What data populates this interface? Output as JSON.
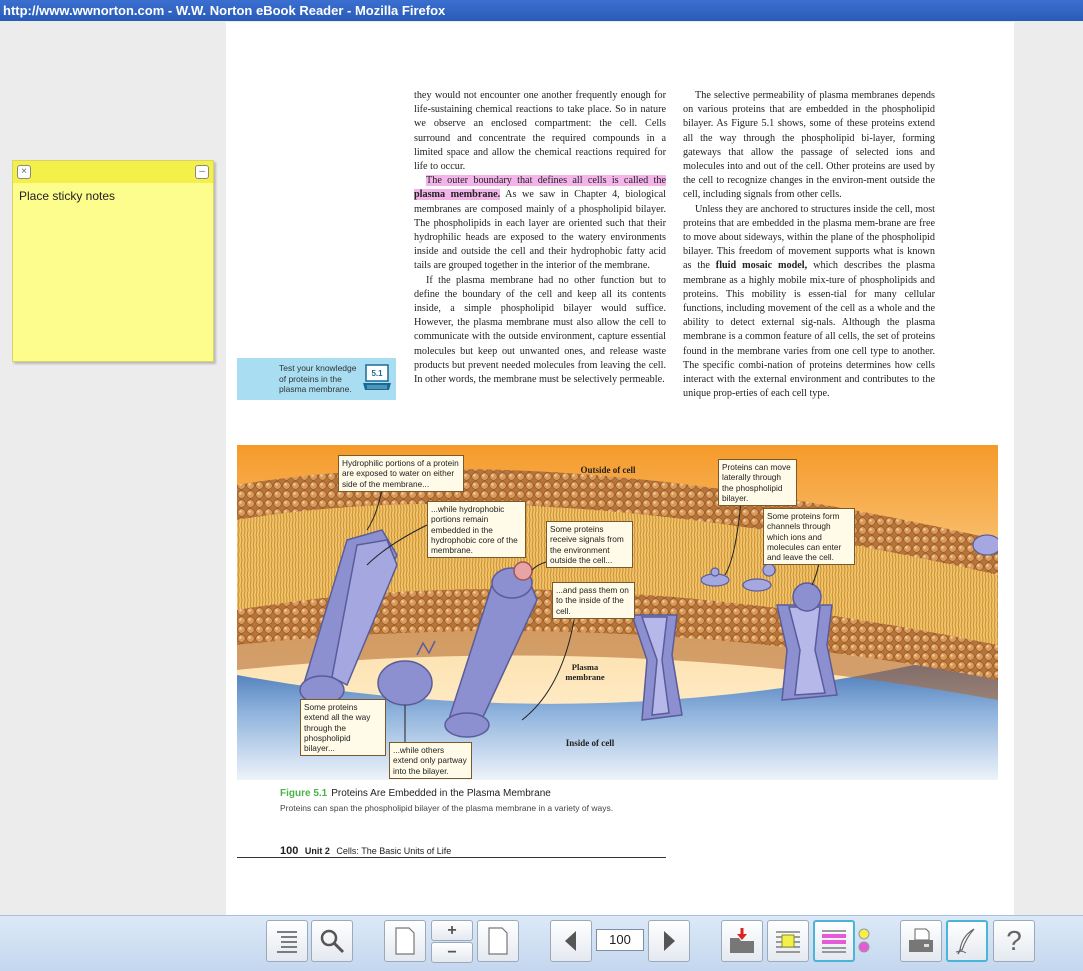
{
  "window": {
    "title": "http://www.wwnorton.com - W.W. Norton eBook Reader - Mozilla Firefox"
  },
  "sticky_note": {
    "text": "Place sticky notes"
  },
  "book": {
    "left_column": {
      "p1": "they would not encounter one another frequently enough for life-sustaining chemical reactions to take place. So in nature we observe an enclosed compartment: the cell. Cells surround and concentrate the required compounds in a limited space and allow the chemical reactions required for life to occur.",
      "p2_highlight": "The outer boundary that defines all cells is called the",
      "p2_highlight_bold": "plasma membrane.",
      "p2_rest": " As we saw in Chapter 4, biological membranes are composed mainly of a phospholipid bilayer. The phospholipids in each layer are oriented such that their hydrophilic heads are exposed to the watery environments inside and outside the cell and their hydrophobic fatty acid tails are grouped together in the interior of the membrane.",
      "p3": "If the plasma membrane had no other function but to define the boundary of the cell and keep all its contents inside, a simple phospholipid bilayer would suffice. However, the plasma membrane must also allow the cell to communicate with the outside environment, capture essential molecules but keep out unwanted ones, and release waste products but prevent needed molecules from leaving the cell. In other words, the membrane must be selectively permeable."
    },
    "right_column": {
      "p1": "The selective permeability of plasma membranes depends on various proteins that are embedded in the phospholipid bilayer. As Figure 5.1 shows, some of these proteins extend all the way through the phospholipid bi-layer, forming gateways that allow the passage of selected ions and molecules into and out of the cell. Other proteins are used by the cell to recognize changes in the environ-ment outside the cell, including signals from other cells.",
      "p2_start": "Unless they are anchored to structures inside the cell, most proteins that are embedded in the plasma mem-brane are free to move about sideways, within the plane of the phospholipid bilayer. This freedom of movement supports what is known as the ",
      "p2_bold": "fluid mosaic model,",
      "p2_end": " which describes the plasma membrane as a highly mobile mix-ture of phospholipids and proteins. This mobility is essen-tial for many cellular functions, including movement of the cell as a whole and the ability to detect external sig-nals. Although the plasma membrane is a common feature of all cells, the set of proteins found in the membrane varies from one cell type to another. The specific combi-nation of proteins determines how cells interact with the external environment and contributes to the unique prop-erties of each cell type."
    },
    "test_box": {
      "text": "Test your knowledge of proteins in the plasma membrane.",
      "badge": "5.1"
    },
    "figure": {
      "labels": {
        "outside": "Outside of cell",
        "inside": "Inside of cell",
        "membrane": "Plasma membrane"
      },
      "callouts": {
        "c1": "Hydrophilic portions of a protein are exposed to water on either side of the membrane...",
        "c2": "...while hydrophobic portions remain embedded in the hydrophobic core of the membrane.",
        "c3": "Some proteins receive signals from the environment outside the cell...",
        "c4": "...and pass them on to the inside of the cell.",
        "c5": "Proteins can move laterally through the phospholipid bilayer.",
        "c6": "Some proteins form channels through which ions and molecules can enter and leave the cell.",
        "c7": "Some proteins extend all the way through the phospholipid bilayer...",
        "c8": "...while others extend only partway into the bilayer."
      },
      "caption_number": "Figure 5.1",
      "caption_title": "Proteins Are Embedded in the Plasma Membrane",
      "caption_sub": "Proteins can span the phospholipid bilayer of the plasma membrane in a variety of ways."
    },
    "footer": {
      "page": "100",
      "unit": "Unit 2",
      "chapter": "Cells: The Basic Units of Life"
    }
  },
  "toolbar": {
    "page_number": "100",
    "help_label": "?",
    "zoom_in": "+",
    "zoom_out": "−"
  }
}
